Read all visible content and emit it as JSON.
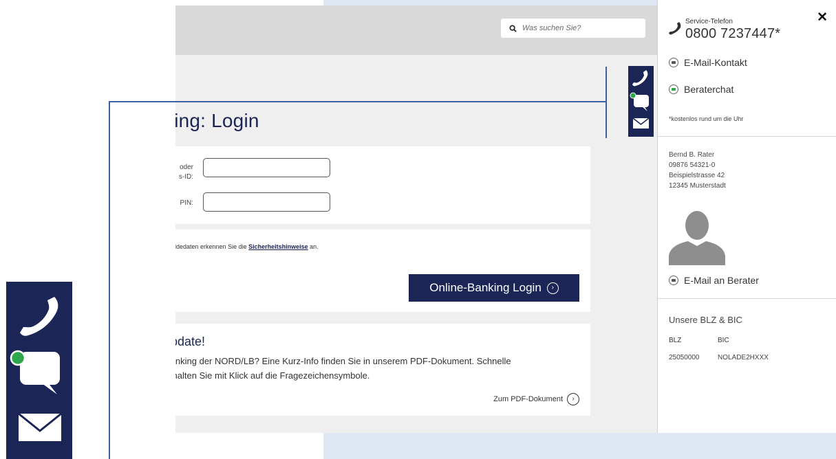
{
  "search": {
    "placeholder": "Was suchen Sie?",
    "icon": "search-icon"
  },
  "page": {
    "title": "king: Login"
  },
  "form": {
    "user_label_line1": "oder",
    "user_label_line2": "s-ID:",
    "pin_label": "PIN:"
  },
  "security": {
    "text_before": "eldedaten erkennen Sie die ",
    "link": "Sicherheitshinweise",
    "text_after": " an."
  },
  "login_button": {
    "label": "Online-Banking Login"
  },
  "update": {
    "title": "Jpdate!",
    "text_line1": "Banking der NORD/LB? Eine Kurz-Info finden Sie in unserem PDF-Dokument. Schnelle",
    "text_line2": "erhalten Sie mit Klick auf die Fragezeichensymbole.",
    "pdf_link": "Zum PDF-Dokument"
  },
  "panel": {
    "service_label": "Service-Telefon",
    "service_number": "0800 7237447*",
    "email_contact": "E-Mail-Kontakt",
    "advisor_chat": "Beraterchat",
    "footnote": "*kostenlos rund um die Uhr",
    "advisor": {
      "name": "Bernd B. Rater",
      "phone": "09876 54321-0",
      "street": "Beispielstrasse 42",
      "city": "12345 Musterstadt"
    },
    "email_advisor": "E-Mail an Berater",
    "blz_title": "Unsere BLZ & BIC",
    "blz_label": "BLZ",
    "bic_label": "BIC",
    "blz_value": "25050000",
    "bic_value": "NOLADE2HXXX"
  },
  "colors": {
    "navy": "#1b2556",
    "accent_green": "#2ea84a",
    "callout_line": "#3d5fa6",
    "band": "#dfe7f2"
  }
}
